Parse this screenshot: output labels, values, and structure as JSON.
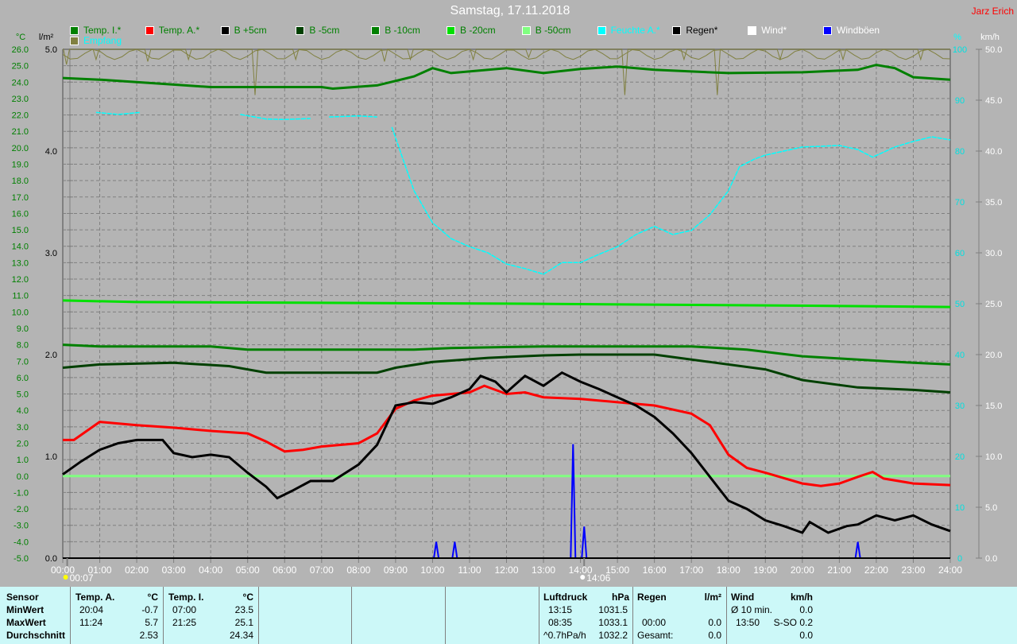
{
  "title": "Samstag, 17.11.2018",
  "author": "Jarz Erich",
  "legend": [
    {
      "label": "Temp. I.*",
      "color": "#008000",
      "text_color": "#008000"
    },
    {
      "label": "Temp. A.*",
      "color": "#ff0000",
      "text_color": "#008000"
    },
    {
      "label": "B +5cm",
      "color": "#000000",
      "text_color": "#008000"
    },
    {
      "label": "B -5cm",
      "color": "#004000",
      "text_color": "#008000"
    },
    {
      "label": "B -10cm",
      "color": "#008000",
      "text_color": "#008000"
    },
    {
      "label": "B -20cm",
      "color": "#00e000",
      "text_color": "#008000"
    },
    {
      "label": "B -50cm",
      "color": "#80ff80",
      "text_color": "#008000"
    },
    {
      "label": "Feuchte A.*",
      "color": "#00ffff",
      "text_color": "#00ffff"
    },
    {
      "label": "Regen*",
      "color": "#000000",
      "text_color": "#000000"
    },
    {
      "label": "Wind*",
      "color": "#ffffff",
      "text_color": "#ffffff"
    },
    {
      "label": "Windböen",
      "color": "#0000ff",
      "text_color": "#ffffff"
    },
    {
      "label": "Empfang",
      "color": "#808040",
      "text_color": "#00ffff"
    }
  ],
  "chart_data": {
    "type": "line",
    "title": "Samstag, 17.11.2018",
    "xlabel": "",
    "xlim": [
      0,
      24
    ],
    "x_ticks": [
      "00:00",
      "01:00",
      "02:00",
      "03:00",
      "04:00",
      "05:00",
      "06:00",
      "07:00",
      "08:00",
      "09:00",
      "10:00",
      "11:00",
      "12:00",
      "13:00",
      "14:00",
      "15:00",
      "16:00",
      "17:00",
      "18:00",
      "19:00",
      "20:00",
      "21:00",
      "22:00",
      "23:00",
      "24:00"
    ],
    "axes": {
      "temp": {
        "unit": "°C",
        "ylim": [
          -5,
          26
        ],
        "ticks": [
          "26.0",
          "25.0",
          "24.0",
          "23.0",
          "22.0",
          "21.0",
          "20.0",
          "19.0",
          "18.0",
          "17.0",
          "16.0",
          "15.0",
          "14.0",
          "13.0",
          "12.0",
          "11.0",
          "10.0",
          "9.0",
          "8.0",
          "7.0",
          "6.0",
          "5.0",
          "4.0",
          "3.0",
          "2.0",
          "1.0",
          "0.0",
          "-1.0",
          "-2.0",
          "-3.0",
          "-4.0",
          "-5.0"
        ]
      },
      "rain": {
        "unit": "l/m²",
        "ylim": [
          0,
          5
        ],
        "ticks": [
          "5.0",
          "4.0",
          "3.0",
          "2.0",
          "1.0",
          "0.0"
        ]
      },
      "humidity": {
        "unit": "%",
        "ylim": [
          0,
          100
        ],
        "ticks": [
          "100",
          "90",
          "80",
          "70",
          "60",
          "50",
          "40",
          "30",
          "20",
          "10",
          "0"
        ]
      },
      "wind": {
        "unit": "km/h",
        "ylim": [
          0,
          50
        ],
        "ticks": [
          "50.0",
          "45.0",
          "40.0",
          "35.0",
          "30.0",
          "25.0",
          "20.0",
          "15.0",
          "10.0",
          "5.0",
          "0.0"
        ]
      }
    },
    "grid": true,
    "markers": [
      {
        "label": "00:07",
        "x": 0.12,
        "kind": "sunrise-moon"
      },
      {
        "label": "14:06",
        "x": 14.1,
        "kind": "moonset"
      }
    ],
    "series": [
      {
        "name": "Temp. I.*",
        "axis": "temp",
        "color": "#008000",
        "points": [
          [
            0,
            24.25
          ],
          [
            1,
            24.15
          ],
          [
            3,
            23.85
          ],
          [
            4,
            23.7
          ],
          [
            7,
            23.7
          ],
          [
            7.3,
            23.6
          ],
          [
            8.5,
            23.8
          ],
          [
            9.5,
            24.35
          ],
          [
            10,
            24.85
          ],
          [
            10.5,
            24.55
          ],
          [
            12,
            24.85
          ],
          [
            13,
            24.55
          ],
          [
            14,
            24.8
          ],
          [
            15,
            24.95
          ],
          [
            16,
            24.75
          ],
          [
            17,
            24.65
          ],
          [
            18,
            24.55
          ],
          [
            20,
            24.6
          ],
          [
            21.5,
            24.75
          ],
          [
            22,
            25.05
          ],
          [
            22.5,
            24.85
          ],
          [
            23,
            24.3
          ],
          [
            24,
            24.15
          ]
        ]
      },
      {
        "name": "Temp. A.*",
        "axis": "temp",
        "color": "#ff0000",
        "points": [
          [
            0,
            2.2
          ],
          [
            0.3,
            2.2
          ],
          [
            1,
            3.3
          ],
          [
            2,
            3.1
          ],
          [
            3,
            2.95
          ],
          [
            4,
            2.75
          ],
          [
            5,
            2.6
          ],
          [
            5.5,
            2.1
          ],
          [
            6,
            1.5
          ],
          [
            6.5,
            1.6
          ],
          [
            7,
            1.8
          ],
          [
            8,
            2.0
          ],
          [
            8.5,
            2.6
          ],
          [
            9,
            4.1
          ],
          [
            9.5,
            4.6
          ],
          [
            10,
            4.9
          ],
          [
            11,
            5.1
          ],
          [
            11.4,
            5.5
          ],
          [
            12,
            5.0
          ],
          [
            12.5,
            5.1
          ],
          [
            13,
            4.8
          ],
          [
            14,
            4.7
          ],
          [
            15,
            4.5
          ],
          [
            16,
            4.3
          ],
          [
            17,
            3.8
          ],
          [
            17.5,
            3.1
          ],
          [
            18,
            1.3
          ],
          [
            18.5,
            0.5
          ],
          [
            19,
            0.2
          ],
          [
            20,
            -0.45
          ],
          [
            20.5,
            -0.6
          ],
          [
            21,
            -0.45
          ],
          [
            21.5,
            -0.05
          ],
          [
            21.9,
            0.25
          ],
          [
            22.2,
            -0.15
          ],
          [
            23,
            -0.45
          ],
          [
            24,
            -0.55
          ]
        ]
      },
      {
        "name": "B +5cm",
        "axis": "temp",
        "color": "#000000",
        "points": [
          [
            0,
            0.1
          ],
          [
            0.5,
            0.9
          ],
          [
            1,
            1.6
          ],
          [
            1.5,
            2.0
          ],
          [
            2,
            2.2
          ],
          [
            2.7,
            2.2
          ],
          [
            3,
            1.4
          ],
          [
            3.5,
            1.15
          ],
          [
            4,
            1.3
          ],
          [
            4.5,
            1.15
          ],
          [
            5,
            0.2
          ],
          [
            5.5,
            -0.65
          ],
          [
            5.8,
            -1.35
          ],
          [
            6.2,
            -0.9
          ],
          [
            6.7,
            -0.3
          ],
          [
            7.3,
            -0.3
          ],
          [
            8,
            0.7
          ],
          [
            8.5,
            1.9
          ],
          [
            9,
            4.3
          ],
          [
            9.5,
            4.5
          ],
          [
            10,
            4.4
          ],
          [
            10.5,
            4.8
          ],
          [
            11,
            5.3
          ],
          [
            11.3,
            6.1
          ],
          [
            11.7,
            5.75
          ],
          [
            12,
            5.1
          ],
          [
            12.5,
            6.1
          ],
          [
            13,
            5.5
          ],
          [
            13.5,
            6.3
          ],
          [
            14,
            5.75
          ],
          [
            14.5,
            5.3
          ],
          [
            15,
            4.8
          ],
          [
            15.5,
            4.3
          ],
          [
            16,
            3.6
          ],
          [
            16.5,
            2.6
          ],
          [
            17,
            1.4
          ],
          [
            17.5,
            -0.05
          ],
          [
            18,
            -1.5
          ],
          [
            18.5,
            -2.0
          ],
          [
            19,
            -2.7
          ],
          [
            19.5,
            -3.05
          ],
          [
            20,
            -3.45
          ],
          [
            20.2,
            -2.8
          ],
          [
            20.7,
            -3.45
          ],
          [
            21.2,
            -3.05
          ],
          [
            21.5,
            -2.95
          ],
          [
            22,
            -2.4
          ],
          [
            22.5,
            -2.7
          ],
          [
            23,
            -2.4
          ],
          [
            23.5,
            -2.95
          ],
          [
            24,
            -3.35
          ]
        ]
      },
      {
        "name": "B -5cm",
        "axis": "temp",
        "color": "#004000",
        "points": [
          [
            0,
            6.6
          ],
          [
            1,
            6.8
          ],
          [
            3,
            6.9
          ],
          [
            4.5,
            6.7
          ],
          [
            5.5,
            6.3
          ],
          [
            8.5,
            6.3
          ],
          [
            9,
            6.6
          ],
          [
            10,
            6.95
          ],
          [
            11.5,
            7.2
          ],
          [
            13,
            7.35
          ],
          [
            14,
            7.4
          ],
          [
            16,
            7.4
          ],
          [
            17.5,
            6.95
          ],
          [
            19,
            6.5
          ],
          [
            20,
            5.85
          ],
          [
            21.5,
            5.4
          ],
          [
            23,
            5.25
          ],
          [
            24,
            5.1
          ]
        ]
      },
      {
        "name": "B -10cm",
        "axis": "temp",
        "color": "#008000",
        "points": [
          [
            0,
            8.0
          ],
          [
            1,
            7.9
          ],
          [
            4,
            7.9
          ],
          [
            5,
            7.7
          ],
          [
            9.5,
            7.7
          ],
          [
            10.5,
            7.8
          ],
          [
            13,
            7.9
          ],
          [
            17,
            7.9
          ],
          [
            18.5,
            7.7
          ],
          [
            20,
            7.3
          ],
          [
            21.5,
            7.1
          ],
          [
            23,
            6.9
          ],
          [
            24,
            6.8
          ]
        ]
      },
      {
        "name": "B -20cm",
        "axis": "temp",
        "color": "#00e000",
        "points": [
          [
            0,
            10.7
          ],
          [
            2,
            10.6
          ],
          [
            12.5,
            10.5
          ],
          [
            19,
            10.4
          ],
          [
            24,
            10.3
          ]
        ]
      },
      {
        "name": "B -50cm",
        "axis": "temp",
        "color": "#80ff80",
        "points": [
          [
            0,
            0.0
          ],
          [
            24,
            0.0
          ]
        ]
      },
      {
        "name": "Feuchte A.*",
        "axis": "humidity",
        "color": "#00ffff",
        "segments": [
          [
            [
              0.9,
              87.6
            ],
            [
              1.5,
              87.2
            ],
            [
              2.1,
              87.6
            ]
          ],
          [
            [
              4.8,
              87.2
            ],
            [
              5.5,
              86.3
            ],
            [
              6,
              86.2
            ],
            [
              6.7,
              86.4
            ]
          ],
          [
            [
              7.2,
              86.7
            ],
            [
              8,
              86.9
            ],
            [
              8.5,
              86.7
            ]
          ],
          [
            [
              8.9,
              84.7
            ],
            [
              9.2,
              78.4
            ],
            [
              9.5,
              72.2
            ],
            [
              10,
              65.9
            ],
            [
              10.5,
              62.8
            ],
            [
              11,
              61.2
            ],
            [
              11.5,
              60
            ],
            [
              12,
              57.8
            ],
            [
              12.5,
              56.9
            ],
            [
              13,
              55.8
            ],
            [
              13.5,
              58.1
            ],
            [
              14,
              58.1
            ],
            [
              14.5,
              59.7
            ],
            [
              15,
              61.2
            ],
            [
              15.5,
              63.6
            ],
            [
              16,
              65.2
            ],
            [
              16.5,
              63.6
            ],
            [
              17,
              64.4
            ],
            [
              17.5,
              67.5
            ],
            [
              18,
              72.2
            ],
            [
              18.3,
              76.9
            ],
            [
              18.7,
              78.4
            ],
            [
              19,
              79.2
            ],
            [
              20,
              80.8
            ],
            [
              21,
              81.1
            ],
            [
              21.5,
              80.3
            ],
            [
              21.9,
              78.8
            ],
            [
              22.5,
              80.8
            ],
            [
              23,
              81.9
            ],
            [
              23.5,
              82.8
            ],
            [
              24,
              82.2
            ]
          ]
        ]
      },
      {
        "name": "Regen*",
        "axis": "rain",
        "color": "#000000",
        "points": [
          [
            0,
            0
          ],
          [
            24,
            0
          ]
        ]
      },
      {
        "name": "Wind*",
        "axis": "wind",
        "color": "#ffffff",
        "points": [
          [
            0,
            0
          ],
          [
            24,
            0
          ]
        ]
      },
      {
        "name": "Windböen",
        "axis": "wind",
        "color": "#0000ff",
        "spikes": [
          [
            10.1,
            1.6
          ],
          [
            10.6,
            1.6
          ],
          [
            13.8,
            11.2
          ],
          [
            14.1,
            3.1
          ],
          [
            21.5,
            1.6
          ]
        ]
      },
      {
        "name": "Empfang",
        "axis": "rain",
        "color": "#808040",
        "baseline": 5.0,
        "dips": [
          [
            0.1,
            4.85
          ],
          [
            0.9,
            4.9
          ],
          [
            2.3,
            4.88
          ],
          [
            3.4,
            4.9
          ],
          [
            5.2,
            4.55
          ],
          [
            6.3,
            4.9
          ],
          [
            8.7,
            4.88
          ],
          [
            9.4,
            4.9
          ],
          [
            11.1,
            4.9
          ],
          [
            12.6,
            4.92
          ],
          [
            15.2,
            4.55
          ],
          [
            16.8,
            4.9
          ],
          [
            17.7,
            4.55
          ],
          [
            19.4,
            4.9
          ],
          [
            21.1,
            4.9
          ],
          [
            23.2,
            4.9
          ]
        ]
      }
    ]
  },
  "stats": {
    "sensor": {
      "header": "Sensor",
      "min": "MinWert",
      "max": "MaxWert",
      "avg": "Durchschnitt"
    },
    "temp_a": {
      "header": "Temp. A.",
      "unit": "°C",
      "min_time": "20:04",
      "min": "-0.7",
      "max_time": "11:24",
      "max": "5.7",
      "avg": "2.53"
    },
    "temp_i": {
      "header": "Temp. I.",
      "unit": "°C",
      "min_time": "07:00",
      "min": "23.5",
      "max_time": "21:25",
      "max": "25.1",
      "avg": "24.34"
    },
    "pressure": {
      "header": "Luftdruck",
      "unit": "hPa",
      "min_time": "13:15",
      "min": "1031.5",
      "max_time": "08:35",
      "max": "1033.1",
      "trend": "^0.7hPa/h",
      "avg": "1032.2"
    },
    "rain": {
      "header": "Regen",
      "unit": "l/m²",
      "max_time": "00:00",
      "max": "0.0",
      "total_label": "Gesamt:",
      "total": "0.0"
    },
    "wind": {
      "header": "Wind",
      "unit": "km/h",
      "avg_label": "Ø 10 min.",
      "avg": "0.0",
      "max_time": "13:50",
      "max": "S-SO 0.2",
      "last": "0.0"
    }
  }
}
